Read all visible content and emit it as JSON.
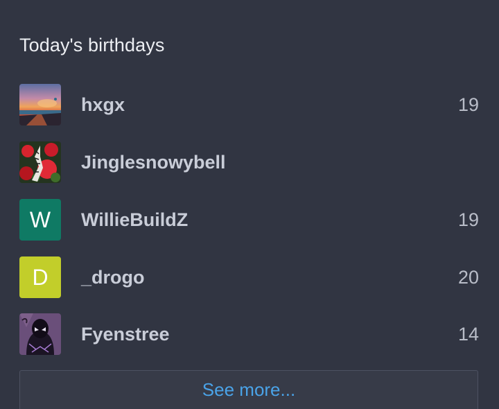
{
  "widget": {
    "title": "Today's birthdays",
    "see_more_label": "See more..."
  },
  "users": [
    {
      "name": "hxgx",
      "age": "19",
      "avatar": "sunset-photo-avatar"
    },
    {
      "name": "Jinglesnowybell",
      "age": "",
      "avatar": "butterfly-flowers-avatar"
    },
    {
      "name": "WillieBuildZ",
      "age": "19",
      "avatar_initial": "W",
      "avatar_color": "#0f7a64"
    },
    {
      "name": "_drogo",
      "age": "20",
      "avatar_initial": "D",
      "avatar_color": "#c2ce2a"
    },
    {
      "name": "Fyenstree",
      "age": "14",
      "avatar": "masked-hero-avatar"
    }
  ],
  "colors": {
    "background": "#313542",
    "link": "#4aa3e8"
  }
}
